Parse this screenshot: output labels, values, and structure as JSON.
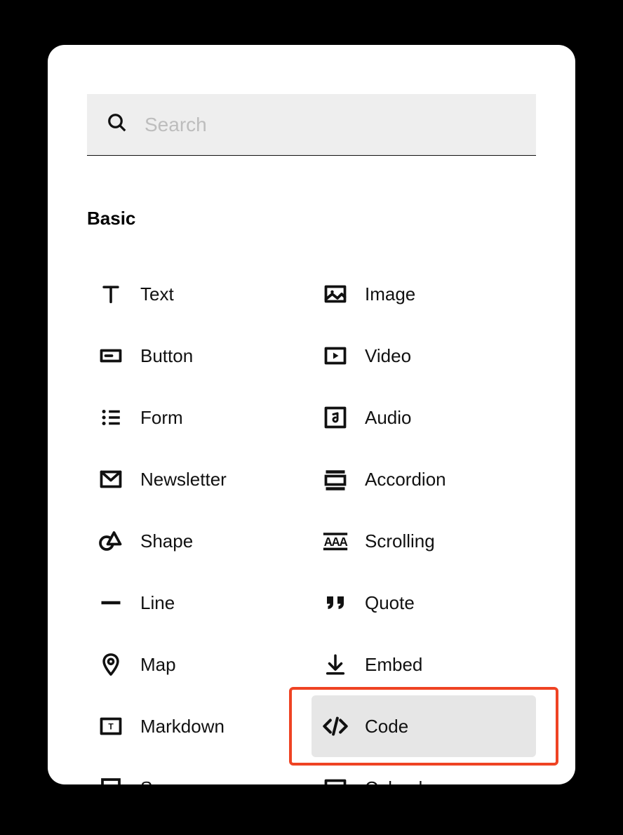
{
  "search": {
    "placeholder": "Search",
    "value": ""
  },
  "section": {
    "title": "Basic"
  },
  "items_left": [
    {
      "label": "Text",
      "icon": "text",
      "slug": "text"
    },
    {
      "label": "Button",
      "icon": "button",
      "slug": "button"
    },
    {
      "label": "Form",
      "icon": "form",
      "slug": "form"
    },
    {
      "label": "Newsletter",
      "icon": "newsletter",
      "slug": "newsletter"
    },
    {
      "label": "Shape",
      "icon": "shape",
      "slug": "shape"
    },
    {
      "label": "Line",
      "icon": "line",
      "slug": "line"
    },
    {
      "label": "Map",
      "icon": "map",
      "slug": "map"
    },
    {
      "label": "Markdown",
      "icon": "markdown",
      "slug": "markdown"
    },
    {
      "label": "Summary",
      "icon": "summary",
      "slug": "summary"
    }
  ],
  "items_right": [
    {
      "label": "Image",
      "icon": "image",
      "slug": "image"
    },
    {
      "label": "Video",
      "icon": "video",
      "slug": "video"
    },
    {
      "label": "Audio",
      "icon": "audio",
      "slug": "audio"
    },
    {
      "label": "Accordion",
      "icon": "accordion",
      "slug": "accordion"
    },
    {
      "label": "Scrolling",
      "icon": "scrolling",
      "slug": "scrolling"
    },
    {
      "label": "Quote",
      "icon": "quote",
      "slug": "quote"
    },
    {
      "label": "Embed",
      "icon": "embed",
      "slug": "embed"
    },
    {
      "label": "Code",
      "icon": "code",
      "slug": "code",
      "highlighted": true
    },
    {
      "label": "Calendar",
      "icon": "calendar",
      "slug": "calendar"
    }
  ],
  "annotation": {
    "highlighted_item": "code"
  }
}
